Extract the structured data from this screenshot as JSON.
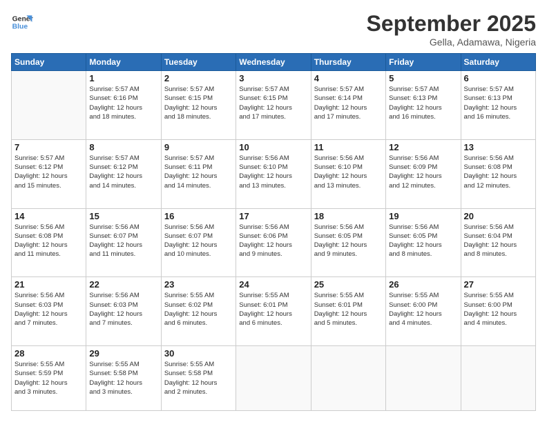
{
  "logo": {
    "line1": "General",
    "line2": "Blue"
  },
  "title": "September 2025",
  "location": "Gella, Adamawa, Nigeria",
  "days_of_week": [
    "Sunday",
    "Monday",
    "Tuesday",
    "Wednesday",
    "Thursday",
    "Friday",
    "Saturday"
  ],
  "weeks": [
    [
      {
        "num": "",
        "info": ""
      },
      {
        "num": "1",
        "info": "Sunrise: 5:57 AM\nSunset: 6:16 PM\nDaylight: 12 hours\nand 18 minutes."
      },
      {
        "num": "2",
        "info": "Sunrise: 5:57 AM\nSunset: 6:15 PM\nDaylight: 12 hours\nand 18 minutes."
      },
      {
        "num": "3",
        "info": "Sunrise: 5:57 AM\nSunset: 6:15 PM\nDaylight: 12 hours\nand 17 minutes."
      },
      {
        "num": "4",
        "info": "Sunrise: 5:57 AM\nSunset: 6:14 PM\nDaylight: 12 hours\nand 17 minutes."
      },
      {
        "num": "5",
        "info": "Sunrise: 5:57 AM\nSunset: 6:13 PM\nDaylight: 12 hours\nand 16 minutes."
      },
      {
        "num": "6",
        "info": "Sunrise: 5:57 AM\nSunset: 6:13 PM\nDaylight: 12 hours\nand 16 minutes."
      }
    ],
    [
      {
        "num": "7",
        "info": "Sunrise: 5:57 AM\nSunset: 6:12 PM\nDaylight: 12 hours\nand 15 minutes."
      },
      {
        "num": "8",
        "info": "Sunrise: 5:57 AM\nSunset: 6:12 PM\nDaylight: 12 hours\nand 14 minutes."
      },
      {
        "num": "9",
        "info": "Sunrise: 5:57 AM\nSunset: 6:11 PM\nDaylight: 12 hours\nand 14 minutes."
      },
      {
        "num": "10",
        "info": "Sunrise: 5:56 AM\nSunset: 6:10 PM\nDaylight: 12 hours\nand 13 minutes."
      },
      {
        "num": "11",
        "info": "Sunrise: 5:56 AM\nSunset: 6:10 PM\nDaylight: 12 hours\nand 13 minutes."
      },
      {
        "num": "12",
        "info": "Sunrise: 5:56 AM\nSunset: 6:09 PM\nDaylight: 12 hours\nand 12 minutes."
      },
      {
        "num": "13",
        "info": "Sunrise: 5:56 AM\nSunset: 6:08 PM\nDaylight: 12 hours\nand 12 minutes."
      }
    ],
    [
      {
        "num": "14",
        "info": "Sunrise: 5:56 AM\nSunset: 6:08 PM\nDaylight: 12 hours\nand 11 minutes."
      },
      {
        "num": "15",
        "info": "Sunrise: 5:56 AM\nSunset: 6:07 PM\nDaylight: 12 hours\nand 11 minutes."
      },
      {
        "num": "16",
        "info": "Sunrise: 5:56 AM\nSunset: 6:07 PM\nDaylight: 12 hours\nand 10 minutes."
      },
      {
        "num": "17",
        "info": "Sunrise: 5:56 AM\nSunset: 6:06 PM\nDaylight: 12 hours\nand 9 minutes."
      },
      {
        "num": "18",
        "info": "Sunrise: 5:56 AM\nSunset: 6:05 PM\nDaylight: 12 hours\nand 9 minutes."
      },
      {
        "num": "19",
        "info": "Sunrise: 5:56 AM\nSunset: 6:05 PM\nDaylight: 12 hours\nand 8 minutes."
      },
      {
        "num": "20",
        "info": "Sunrise: 5:56 AM\nSunset: 6:04 PM\nDaylight: 12 hours\nand 8 minutes."
      }
    ],
    [
      {
        "num": "21",
        "info": "Sunrise: 5:56 AM\nSunset: 6:03 PM\nDaylight: 12 hours\nand 7 minutes."
      },
      {
        "num": "22",
        "info": "Sunrise: 5:56 AM\nSunset: 6:03 PM\nDaylight: 12 hours\nand 7 minutes."
      },
      {
        "num": "23",
        "info": "Sunrise: 5:55 AM\nSunset: 6:02 PM\nDaylight: 12 hours\nand 6 minutes."
      },
      {
        "num": "24",
        "info": "Sunrise: 5:55 AM\nSunset: 6:01 PM\nDaylight: 12 hours\nand 6 minutes."
      },
      {
        "num": "25",
        "info": "Sunrise: 5:55 AM\nSunset: 6:01 PM\nDaylight: 12 hours\nand 5 minutes."
      },
      {
        "num": "26",
        "info": "Sunrise: 5:55 AM\nSunset: 6:00 PM\nDaylight: 12 hours\nand 4 minutes."
      },
      {
        "num": "27",
        "info": "Sunrise: 5:55 AM\nSunset: 6:00 PM\nDaylight: 12 hours\nand 4 minutes."
      }
    ],
    [
      {
        "num": "28",
        "info": "Sunrise: 5:55 AM\nSunset: 5:59 PM\nDaylight: 12 hours\nand 3 minutes."
      },
      {
        "num": "29",
        "info": "Sunrise: 5:55 AM\nSunset: 5:58 PM\nDaylight: 12 hours\nand 3 minutes."
      },
      {
        "num": "30",
        "info": "Sunrise: 5:55 AM\nSunset: 5:58 PM\nDaylight: 12 hours\nand 2 minutes."
      },
      {
        "num": "",
        "info": ""
      },
      {
        "num": "",
        "info": ""
      },
      {
        "num": "",
        "info": ""
      },
      {
        "num": "",
        "info": ""
      }
    ]
  ]
}
